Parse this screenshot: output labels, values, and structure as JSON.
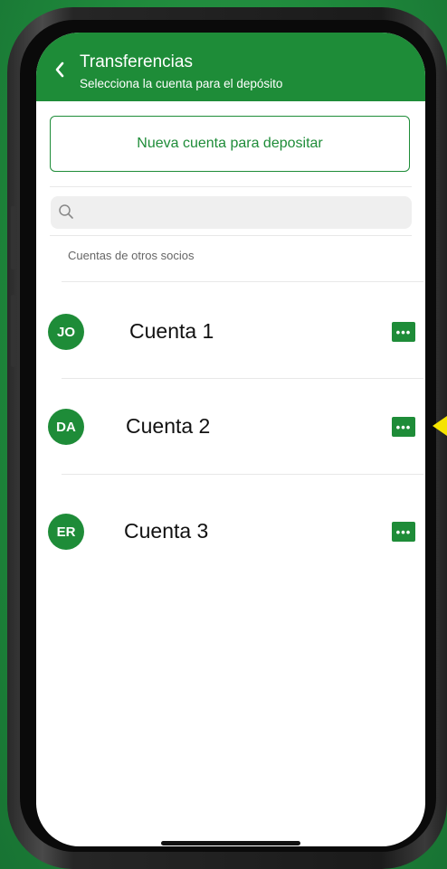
{
  "header": {
    "title": "Transferencias",
    "subtitle": "Selecciona la cuenta para el depósito",
    "back_icon": "chevron-left-icon"
  },
  "new_account_button": "Nueva cuenta para depositar",
  "search": {
    "placeholder": "",
    "icon": "search-icon"
  },
  "section_label": "Cuentas de otros socios",
  "accounts": [
    {
      "initials": "JO",
      "name": "Cuenta 1"
    },
    {
      "initials": "DA",
      "name": "Cuenta 2"
    },
    {
      "initials": "ER",
      "name": "Cuenta 3"
    }
  ],
  "more_icon": "more-options-icon",
  "colors": {
    "brand_green": "#1e8c38",
    "pointer_yellow": "#f5e400"
  }
}
